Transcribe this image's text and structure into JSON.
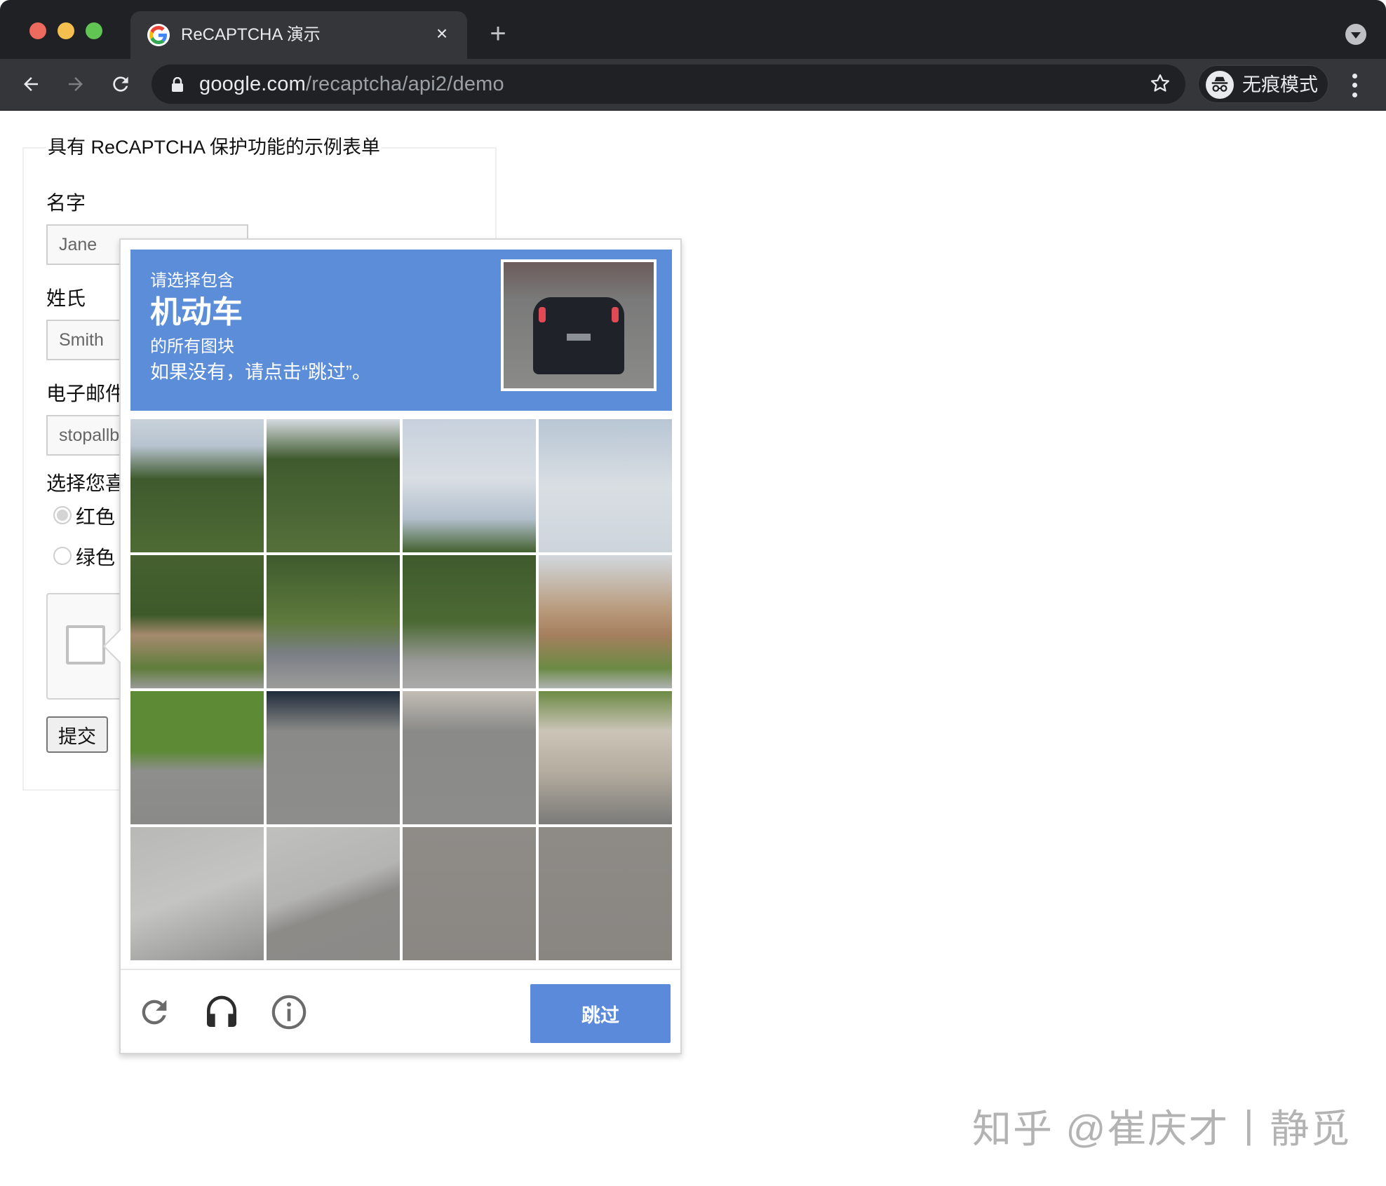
{
  "browser": {
    "tab_title": "ReCAPTCHA 演示",
    "tab_close_glyph": "×",
    "new_tab_glyph": "+",
    "url_host": "google.com",
    "url_path": "/recaptcha/api2/demo",
    "profile_label": "无痕模式",
    "icons": {
      "favicon": "google-g-icon",
      "back": "arrow-left-icon",
      "forward": "arrow-right-icon",
      "reload": "reload-icon",
      "lock": "lock-icon",
      "bookmark": "star-icon",
      "incognito": "incognito-icon",
      "menu": "vertical-dots-icon",
      "tab_search": "chevron-down-icon"
    },
    "colors": {
      "titlebar": "#202124",
      "toolbar": "#35363a",
      "traffic_red": "#ed6a5e",
      "traffic_yellow": "#f5bf4f",
      "traffic_green": "#61c554"
    }
  },
  "form": {
    "legend": "具有 ReCAPTCHA 保护功能的示例表单",
    "fields": [
      {
        "label": "名字",
        "value": "Jane"
      },
      {
        "label": "姓氏",
        "value": "Smith"
      },
      {
        "label": "电子邮件",
        "value": "stopallbots@gmail.com"
      }
    ],
    "color_question": "选择您喜欢的颜色",
    "color_options": [
      {
        "label": "红色",
        "checked": true
      },
      {
        "label": "绿色",
        "checked": false
      }
    ],
    "submit_label": "提交"
  },
  "challenge": {
    "instruction_line1": "请选择包含",
    "target": "机动车",
    "instruction_line3": "的所有图块",
    "instruction_line4": "如果没有，请点击“跳过”。",
    "sample_image": "car-rear-sample",
    "grid": {
      "rows": 4,
      "cols": 4
    },
    "tiles": [
      {
        "row": 1,
        "col": 1,
        "content": "tree and sky"
      },
      {
        "row": 1,
        "col": 2,
        "content": "tree and street lamp"
      },
      {
        "row": 1,
        "col": 3,
        "content": "sky and clouds"
      },
      {
        "row": 1,
        "col": 4,
        "content": "sky and clouds"
      },
      {
        "row": 2,
        "col": 1,
        "content": "tree and houses"
      },
      {
        "row": 2,
        "col": 2,
        "content": "trees and parked cars"
      },
      {
        "row": 2,
        "col": 3,
        "content": "tree and cars on street"
      },
      {
        "row": 2,
        "col": 4,
        "content": "houses"
      },
      {
        "row": 3,
        "col": 1,
        "content": "grass and SUV front"
      },
      {
        "row": 3,
        "col": 2,
        "content": "road and SUV"
      },
      {
        "row": 3,
        "col": 3,
        "content": "road and sedan"
      },
      {
        "row": 3,
        "col": 4,
        "content": "parked sedan"
      },
      {
        "row": 4,
        "col": 1,
        "content": "concrete road"
      },
      {
        "row": 4,
        "col": 2,
        "content": "concrete road"
      },
      {
        "row": 4,
        "col": 3,
        "content": "asphalt road"
      },
      {
        "row": 4,
        "col": 4,
        "content": "asphalt road"
      }
    ],
    "footer_icons": [
      "reload-icon",
      "headphones-icon",
      "info-icon"
    ],
    "skip_label": "跳过",
    "colors": {
      "header": "#5c8dd8",
      "skip_button": "#5a8ad9"
    }
  },
  "watermark": "知乎 @崔庆才丨静觅"
}
